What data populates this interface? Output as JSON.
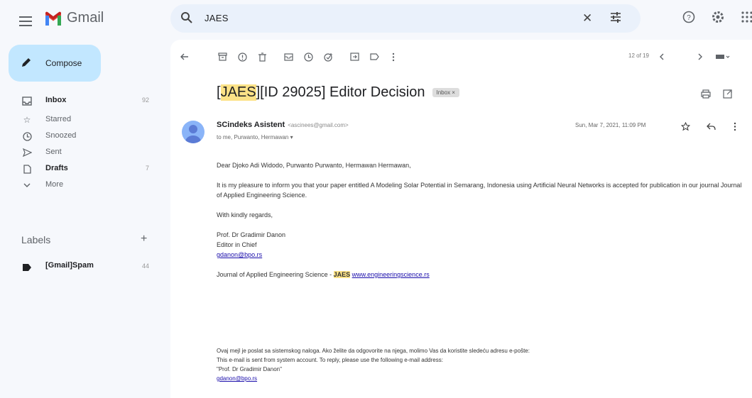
{
  "app": {
    "name": "Gmail"
  },
  "search": {
    "query": "JAES"
  },
  "sidebar": {
    "compose_label": "Compose",
    "items": [
      {
        "label": "Inbox",
        "count": "92",
        "icon": "inbox-icon"
      },
      {
        "label": "Starred",
        "count": "",
        "icon": "star-icon"
      },
      {
        "label": "Snoozed",
        "count": "",
        "icon": "clock-icon"
      },
      {
        "label": "Sent",
        "count": "",
        "icon": "send-icon"
      },
      {
        "label": "Drafts",
        "count": "7",
        "icon": "draft-icon"
      },
      {
        "label": "More",
        "count": "",
        "icon": "chevron-down-icon"
      }
    ],
    "labels_header": "Labels",
    "labels": [
      {
        "label": "[Gmail]Spam",
        "count": "44"
      }
    ]
  },
  "toolbar": {
    "pager": "12 of 19"
  },
  "message": {
    "subject_highlight": "JAES",
    "subject_rest": "][ID 29025] Editor Decision",
    "subject_open": "[",
    "inbox_chip": "Inbox ×",
    "sender_name": "SCindeks Asistent",
    "sender_email": "<ascinees@gmail.com>",
    "recipients": "to me, Purwanto, Hermawan ▾",
    "date": "Sun, Mar 7, 2021, 11:09 PM",
    "greeting": "Dear Djoko Adi Widodo, Purwanto Purwanto, Hermawan Hermawan,",
    "paragraph": "It is my pleasure to inform you that your paper entitled A Modeling Solar Potential in Semarang, Indonesia using Artificial Neural Networks is accepted for publication in our journal Journal of Applied Engineering Science.",
    "closing": "With kindly regards,",
    "sig_name": "Prof. Dr Gradimir Danon",
    "sig_title": "Editor in Chief",
    "sig_email": "gdanon@bpo.rs",
    "journal_text": "Journal of Applied Engineering Science - ",
    "journal_abbr": "JAES",
    "journal_url": "www.engineeringscience.rs",
    "footer_1": "Ovaj mejl je poslat sa sistemskog naloga. Ako želite da odgovorite na njega, molimo Vas da koristite sledeću adresu e-pošte:",
    "footer_2": "This e-mail is sent from system account. To reply, please use the following e-mail address:",
    "footer_3": "\"Prof. Dr Gradimir Danon\"",
    "footer_4": "gdanon@bpo.rs"
  }
}
